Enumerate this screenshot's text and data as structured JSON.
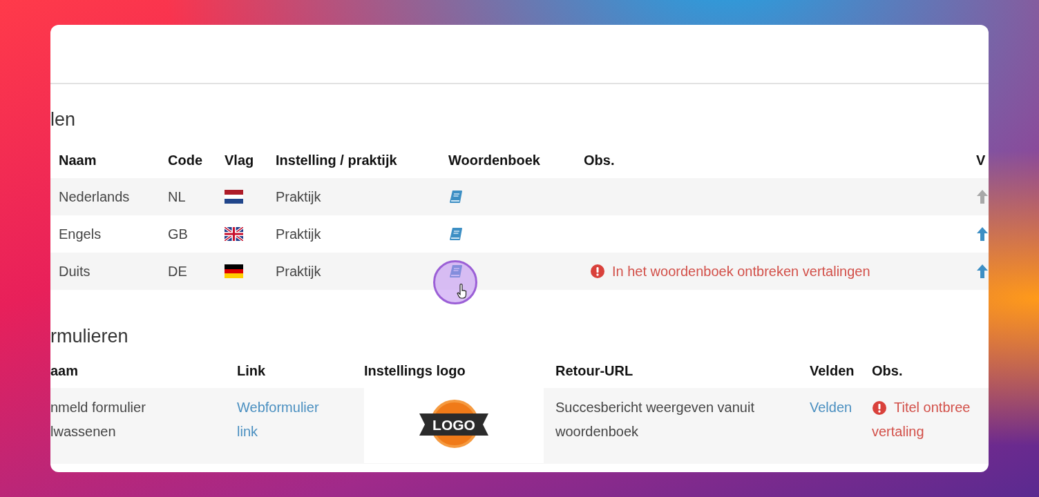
{
  "languages": {
    "title": "len",
    "columns": [
      "Naam",
      "Code",
      "Vlag",
      "Instelling / praktijk",
      "Woordenboek",
      "Obs.",
      "V"
    ],
    "rows": [
      {
        "name": "Nederlands",
        "code": "NL",
        "kind": "nl",
        "setting": "Praktijk",
        "move_up_disabled": true
      },
      {
        "name": "Engels",
        "code": "GB",
        "kind": "gb",
        "setting": "Praktijk",
        "move_up_disabled": false
      },
      {
        "name": "Duits",
        "code": "DE",
        "kind": "de",
        "setting": "Praktijk",
        "obs": "In het woordenboek ontbreken vertalingen",
        "move_up_disabled": false
      }
    ]
  },
  "forms": {
    "title": "rmulieren",
    "columns": [
      "aam",
      "Link",
      "Instellings logo",
      "Retour-URL",
      "Velden",
      "Obs."
    ],
    "rows": [
      {
        "name_lines": [
          "nmeld formulier",
          "lwassenen"
        ],
        "link": "Webformulier link",
        "logo_text": "LOGO",
        "return_url": "Succesbericht weergeven vanuit woordenboek",
        "fields_link": "Velden",
        "obs_lines": [
          "Titel ontbree",
          "vertaling"
        ]
      }
    ]
  }
}
